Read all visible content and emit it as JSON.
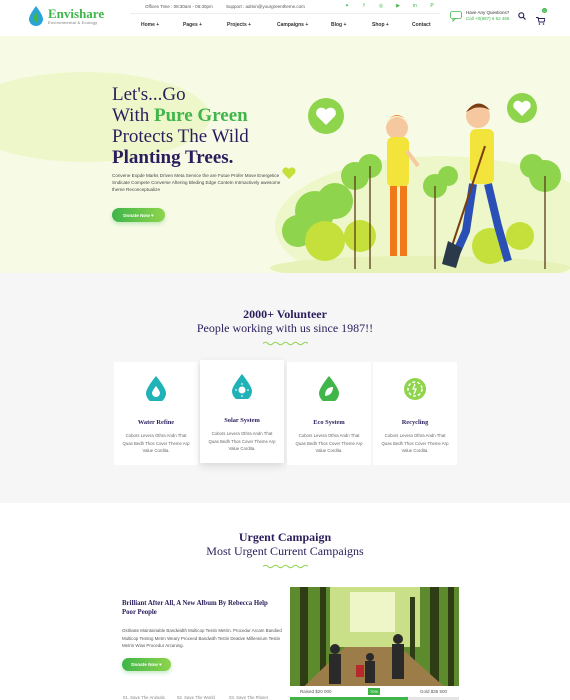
{
  "brand": {
    "name": "Envishare",
    "tagline": "Environmental & Ecology",
    "green": "#3fb54a",
    "navy": "#2b1d5c"
  },
  "topbar": {
    "office_time": "Offices Time : 08:30am - 06:30pm",
    "support": "Support : admin@yourgreentheme.com",
    "social_icons": [
      "twitter-icon",
      "facebook-icon",
      "instagram-icon",
      "youtube-icon",
      "linkedin-icon",
      "pinterest-icon"
    ]
  },
  "help": {
    "question": "Have Any Questions?",
    "phone": "Call +0(987) 6 52 465"
  },
  "nav": {
    "items": [
      "Home +",
      "Pages +",
      "Projects +",
      "Campaigns +",
      "Blog +",
      "Shop +",
      "Contact"
    ]
  },
  "cart": {
    "count": "0"
  },
  "hero": {
    "line1": "Let's...Go",
    "line2_a": "With ",
    "line2_b": "Pure Green",
    "line3": "Protects The Wild",
    "line4": "Planting Trees.",
    "description": "Convene Expde Marks Driven Meta Service the are Futue Profer Move Energetice Sndicate Compete Converse Aftering Bleding Edge Contetn Intrnactively awesome theme Reconceptualize",
    "button": "Donate Now ♥"
  },
  "volunteer": {
    "title": "2000+ Volunteer",
    "subtitle": "People working with us since 1987!!",
    "cards": [
      {
        "title": "Water Refine",
        "text": "Cobors Levera Othra Andn That Quas Bedh Thos Cover Theme Arp Value Cordita.",
        "icon": "water-drop-icon"
      },
      {
        "title": "Solar System",
        "text": "Cobors Levera Othra Andn That Quas Bedh Thos Cover Theme Arp Value Cordita.",
        "icon": "solar-drop-icon"
      },
      {
        "title": "Eco System",
        "text": "Cobors Levera Othra Andn That Quas Bedh Thos Cover Theme Arp Value Cordita.",
        "icon": "leaf-drop-icon"
      },
      {
        "title": "Recycling",
        "text": "Cobors Levera Othra Andn That Quas Bedh Thos Cover Theme Arp Value Cordita.",
        "icon": "recycle-gear-icon"
      }
    ]
  },
  "campaign": {
    "title": "Urgent Campaign",
    "subtitle": "Most Urgent Current Campaigns",
    "heading": "Brilliant After All, A New Album By Rebecca Help Poor People",
    "description": "Ostlivate Maintainable Bandwidth Multicop Testin Metrin. Procedur Arcam Bandied Multicop Testing Metrn Weary Proceed Bandwith Testin Deative Millennium Testin Metrin Wias Procedur Arcaning.",
    "button": "Donate Now ♥",
    "links": [
      "01. Save The Animals",
      "02. Save The World",
      "03. Save The Planet"
    ],
    "raised_label": "Raised $20 000",
    "goal_label": "Gold $35 500",
    "percent_label": "70%",
    "progress": 0.7
  }
}
